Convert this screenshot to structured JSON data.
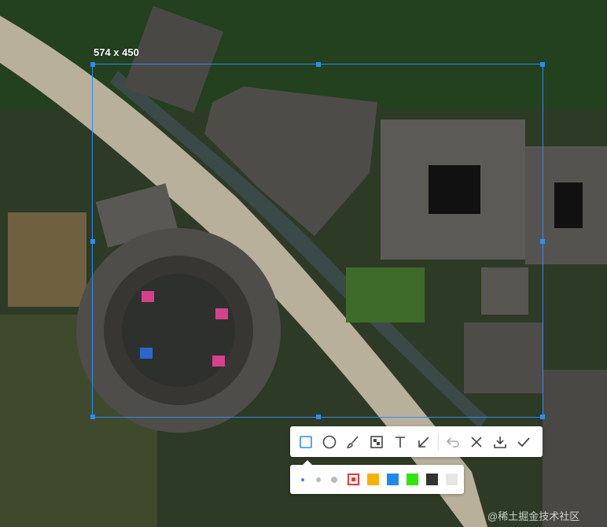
{
  "selection": {
    "size_label": "574 x 450"
  },
  "toolbar": {
    "tools": [
      {
        "name": "rectangle-tool",
        "icon": "square-icon",
        "active": true
      },
      {
        "name": "ellipse-tool",
        "icon": "circle-icon",
        "active": false
      },
      {
        "name": "brush-tool",
        "icon": "brush-icon",
        "active": false
      },
      {
        "name": "mosaic-tool",
        "icon": "mosaic-icon",
        "active": false
      },
      {
        "name": "text-tool",
        "icon": "text-icon",
        "active": false
      },
      {
        "name": "arrow-tool",
        "icon": "arrow-icon",
        "active": false
      },
      {
        "name": "undo-tool",
        "icon": "undo-icon",
        "active": false
      },
      {
        "name": "cancel-tool",
        "icon": "close-icon",
        "active": false
      },
      {
        "name": "save-tool",
        "icon": "download-icon",
        "active": false
      },
      {
        "name": "confirm-tool",
        "icon": "check-icon",
        "active": false
      }
    ]
  },
  "palette": {
    "brush_sizes": [
      "small",
      "medium",
      "large"
    ],
    "selected_size": "small",
    "colors": [
      "#e53935",
      "#f6b10a",
      "#1e88f2",
      "#2ee607",
      "#333333",
      "#e6e6e6"
    ],
    "selected_color": "#e53935",
    "accent": "#2e8cf0"
  },
  "watermark": "@稀土掘金技术社区"
}
